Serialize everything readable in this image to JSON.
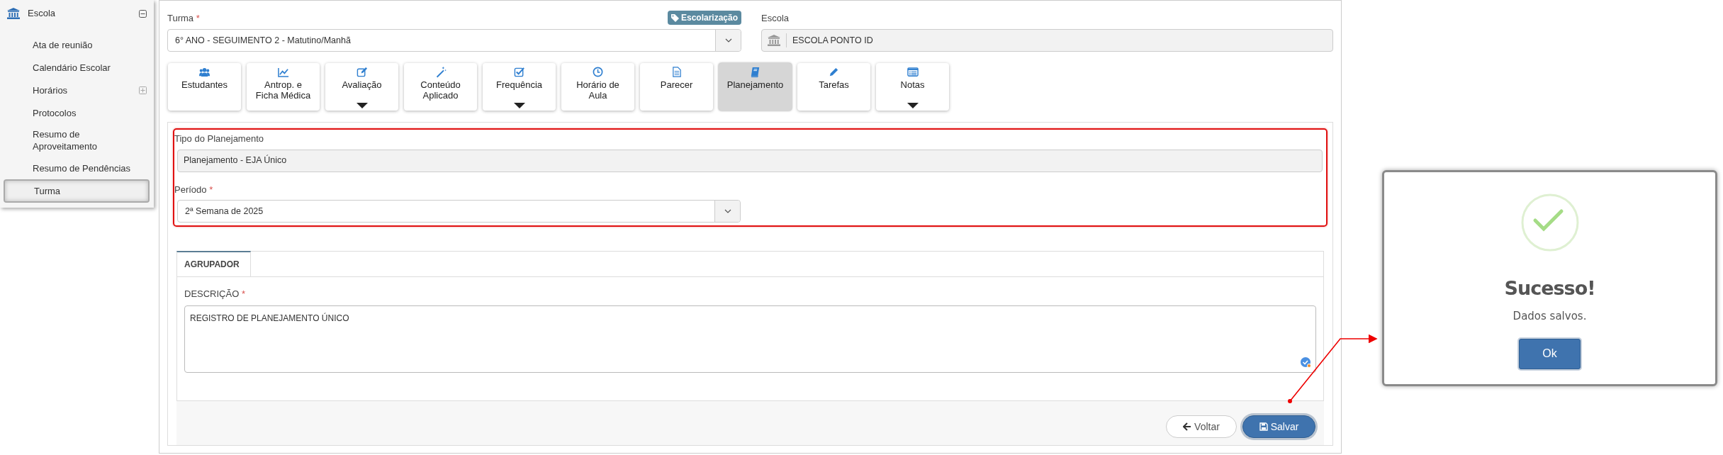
{
  "sidebar": {
    "header": {
      "label": "Escola",
      "expanded": true
    },
    "items": [
      {
        "label": "Ata de reunião",
        "kind": "link",
        "selected": false
      },
      {
        "label": "Calendário Escolar",
        "kind": "link",
        "selected": false
      },
      {
        "label": "Horários",
        "kind": "group",
        "expanded": false,
        "selected": false
      },
      {
        "label": "Protocolos",
        "kind": "link",
        "selected": false
      },
      {
        "label": "Resumo de Aproveitamento",
        "kind": "link",
        "selected": false
      },
      {
        "label": "Resumo de Pendências",
        "kind": "link",
        "selected": false
      },
      {
        "label": "Turma",
        "kind": "link",
        "selected": true
      }
    ]
  },
  "turma": {
    "label": "Turma",
    "required_mark": "*",
    "badge": "Escolarização",
    "value": "6° ANO - SEGUIMENTO 2 - Matutino/Manhã"
  },
  "escola": {
    "label": "Escola",
    "value": "ESCOLA PONTO ID"
  },
  "tabs": [
    {
      "label": "Estudantes",
      "kind": "users",
      "has_menu": false,
      "selected": false
    },
    {
      "label": "Antrop. e\nFicha Médica",
      "kind": "chart",
      "has_menu": false,
      "selected": false
    },
    {
      "label": "Avaliação",
      "kind": "edit",
      "has_menu": true,
      "selected": false
    },
    {
      "label": "Conteúdo\nAplicado",
      "kind": "wand",
      "has_menu": false,
      "selected": false
    },
    {
      "label": "Frequência",
      "kind": "check",
      "has_menu": true,
      "selected": false
    },
    {
      "label": "Horário de\nAula",
      "kind": "clock",
      "has_menu": false,
      "selected": false
    },
    {
      "label": "Parecer",
      "kind": "file",
      "has_menu": false,
      "selected": false
    },
    {
      "label": "Planejamento",
      "kind": "book",
      "has_menu": false,
      "selected": true
    },
    {
      "label": "Tarefas",
      "kind": "pencil",
      "has_menu": false,
      "selected": false
    },
    {
      "label": "Notas",
      "kind": "list",
      "has_menu": true,
      "selected": false
    }
  ],
  "planning": {
    "highlighted": true,
    "type_label": "Tipo do Planejamento",
    "type_value": "Planejamento - EJA Único",
    "period_label": "Período",
    "period_required_mark": "*",
    "period_value": "2ª Semana de 2025"
  },
  "panel_tabs": [
    {
      "label": "AGRUPADOR",
      "selected": true
    }
  ],
  "description": {
    "label": "DESCRIÇÃO",
    "required_mark": "*",
    "value": "REGISTRO DE PLANEJAMENTO ÚNICO"
  },
  "footer": {
    "back": "Voltar",
    "save": "Salvar"
  },
  "dialog": {
    "title": "Sucesso!",
    "message": "Dados salvos.",
    "button": "Ok"
  }
}
